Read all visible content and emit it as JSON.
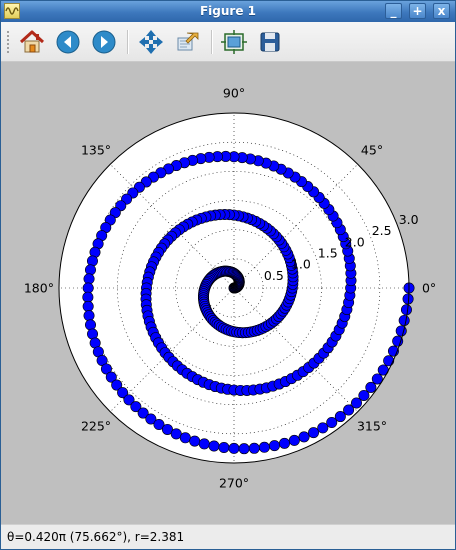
{
  "window": {
    "title": "Figure 1",
    "buttons": {
      "minimize": "_",
      "maximize": "+",
      "close": "x"
    }
  },
  "toolbar": {
    "items": [
      {
        "id": "home",
        "icon": "home-icon"
      },
      {
        "id": "back",
        "icon": "arrow-left-icon"
      },
      {
        "id": "forward",
        "icon": "arrow-right-icon"
      },
      {
        "id": "pan",
        "icon": "pan-arrows-icon"
      },
      {
        "id": "zoom",
        "icon": "zoom-rect-icon"
      },
      {
        "id": "subplots",
        "icon": "configure-subplots-icon"
      },
      {
        "id": "save",
        "icon": "save-icon"
      }
    ]
  },
  "status": {
    "text": "θ=0.420π (75.662°), r=2.381"
  },
  "colors": {
    "figure_background": "#bfbfbf",
    "marker_face": "#0000ff",
    "marker_edge": "#000000"
  },
  "chart_data": {
    "type": "scatter",
    "projection": "polar",
    "angle_unit": "deg",
    "angle_ticks": [
      0,
      45,
      90,
      135,
      180,
      225,
      270,
      315
    ],
    "angle_tick_labels": [
      "0°",
      "45°",
      "90°",
      "135°",
      "180°",
      "225°",
      "270°",
      "315°"
    ],
    "radial_ticks": [
      0.5,
      1.0,
      1.5,
      2.0,
      2.5,
      3.0
    ],
    "radial_tick_labels": [
      "0.5",
      "1.0",
      "1.5",
      "2.0",
      "2.5",
      "3.0"
    ],
    "rlim": [
      0,
      3.0
    ],
    "grid": true,
    "marker": "circle",
    "series": [
      {
        "r": {
          "start": 0.0,
          "end": 3.0,
          "step": 0.01
        },
        "theta": "2π·r"
      }
    ]
  }
}
